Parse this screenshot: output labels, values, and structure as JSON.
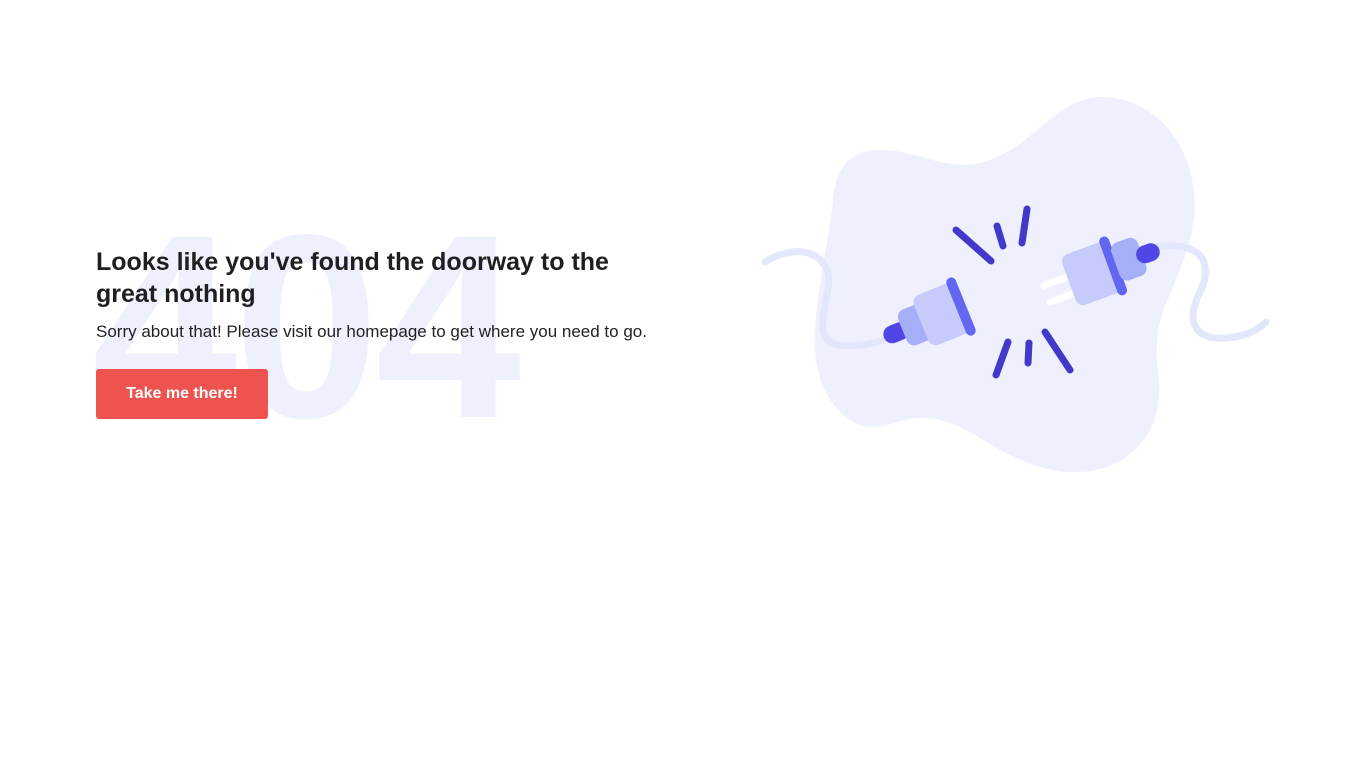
{
  "background_code": "404",
  "heading": "Looks like you've found the doorway to the great nothing",
  "message": "Sorry about that! Please visit our homepage to get where you need to go.",
  "button": {
    "label": "Take me there!"
  },
  "illustration": {
    "icon": "unplugged-cable-icon"
  },
  "colors": {
    "button": "#ef5350",
    "blob": "#eef1fd",
    "accent": "#4f46e5",
    "plug_light": "#c7cbfb",
    "plug_mid": "#a5aff8"
  }
}
